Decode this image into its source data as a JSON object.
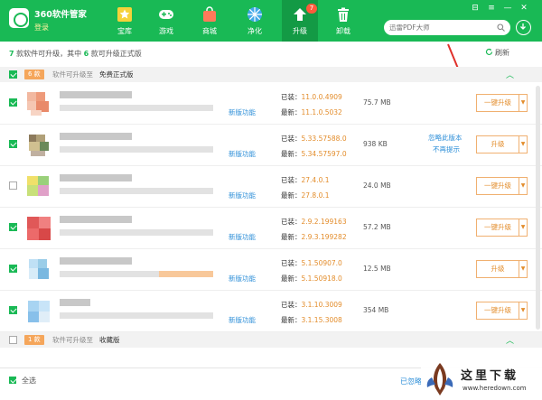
{
  "header": {
    "app_title": "360软件管家",
    "login": "登录",
    "tabs": [
      {
        "label": "宝库",
        "icon": "star-icon"
      },
      {
        "label": "游戏",
        "icon": "gamepad-icon"
      },
      {
        "label": "商城",
        "icon": "shopping-bag-icon"
      },
      {
        "label": "净化",
        "icon": "aperture-icon"
      },
      {
        "label": "升级",
        "icon": "upgrade-arrow-icon",
        "badge": "7",
        "active": true
      },
      {
        "label": "卸载",
        "icon": "trash-icon"
      }
    ],
    "search_placeholder": "迅雷PDF大师",
    "window_controls": [
      "skin",
      "menu",
      "minimize",
      "close"
    ],
    "window_glyphs": [
      "⊟",
      "≡",
      "—",
      "✕"
    ]
  },
  "summary": {
    "count_total": "7",
    "text_a": "款软件可升级，其中",
    "count_official": "6",
    "text_b": "款可升级正式版",
    "refresh_label": "刷新"
  },
  "groups": [
    {
      "count": "6 款",
      "desc": "软件可升级至",
      "target": "免费正式版",
      "checked": true
    },
    {
      "count": "1 款",
      "desc": "软件可升级至",
      "target": "收藏版",
      "checked": false
    }
  ],
  "rows": [
    {
      "checked": true,
      "feature": "新版功能",
      "installed_label": "已装：",
      "installed": "11.0.0.4909",
      "latest_label": "最新：",
      "latest": "11.1.0.5032",
      "size": "75.7 MB",
      "action": "一键升级",
      "ignore": "",
      "noremind": ""
    },
    {
      "checked": true,
      "feature": "新版功能",
      "installed_label": "已装：",
      "installed": "5.33.57588.0",
      "latest_label": "最新：",
      "latest": "5.34.57597.0",
      "size": "938 KB",
      "action": "升级",
      "ignore": "忽略此版本",
      "noremind": "不再提示"
    },
    {
      "checked": false,
      "feature": "新版功能",
      "installed_label": "已装：",
      "installed": "27.4.0.1",
      "latest_label": "最新：",
      "latest": "27.8.0.1",
      "size": "24.0 MB",
      "action": "一键升级",
      "ignore": "",
      "noremind": ""
    },
    {
      "checked": true,
      "feature": "新版功能",
      "installed_label": "已装：",
      "installed": "2.9.2.199163",
      "latest_label": "最新：",
      "latest": "2.9.3.199282",
      "size": "57.2 MB",
      "action": "一键升级",
      "ignore": "",
      "noremind": ""
    },
    {
      "checked": true,
      "feature": "新版功能",
      "installed_label": "已装：",
      "installed": "5.1.50907.0",
      "latest_label": "最新：",
      "latest": "5.1.50918.0",
      "size": "12.5 MB",
      "action": "升级",
      "ignore": "",
      "noremind": ""
    },
    {
      "checked": true,
      "feature": "新版功能",
      "installed_label": "已装：",
      "installed": "3.1.10.3009",
      "latest_label": "最新：",
      "latest": "3.1.15.3008",
      "size": "354 MB",
      "action": "一键升级",
      "ignore": "",
      "noremind": ""
    }
  ],
  "footer": {
    "select_all": "全选",
    "ignored": "已忽略"
  },
  "watermark": {
    "text": "这里下载",
    "url": "www.heredown.com"
  },
  "colors": {
    "brand_green": "#19b955",
    "accent_orange": "#e38d2c",
    "link_blue": "#2e8fd8",
    "annotation_red": "#e0302a"
  }
}
